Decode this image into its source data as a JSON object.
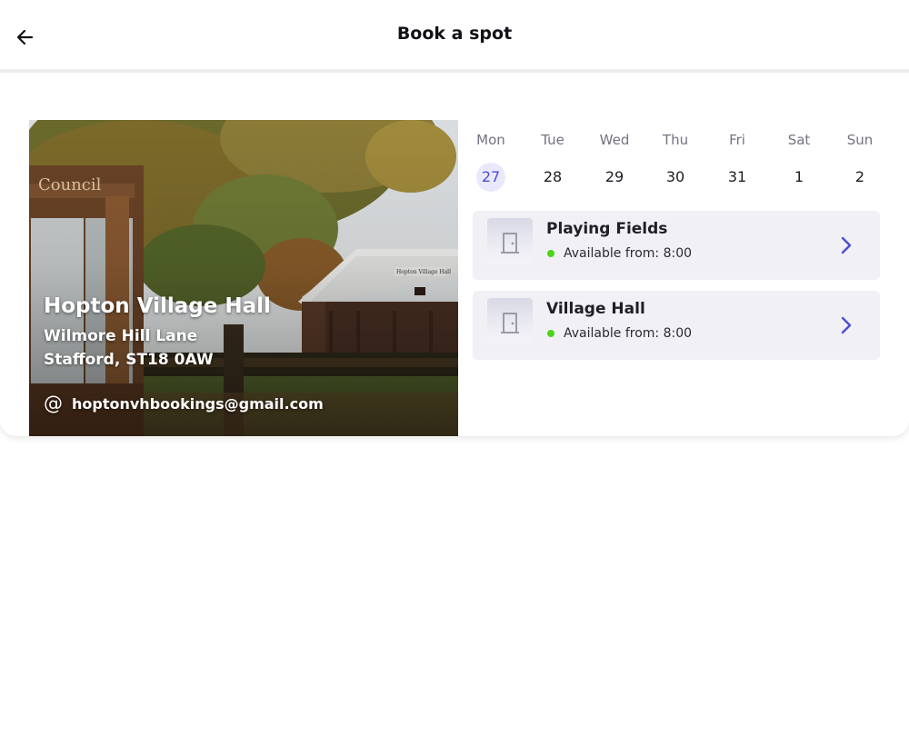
{
  "header": {
    "title": "Book a spot"
  },
  "venue": {
    "name": "Hopton Village Hall",
    "address_line1": "Wilmore Hill Lane",
    "address_line2": "Stafford, ST18 0AW",
    "email": "hoptonvhbookings@gmail.com",
    "photo_sign_text": "Council",
    "photo_hall_sign": "Hopton Village Hall"
  },
  "calendar": {
    "selected_index": 0,
    "days": [
      {
        "name": "Mon",
        "num": "27"
      },
      {
        "name": "Tue",
        "num": "28"
      },
      {
        "name": "Wed",
        "num": "29"
      },
      {
        "name": "Thu",
        "num": "30"
      },
      {
        "name": "Fri",
        "num": "31"
      },
      {
        "name": "Sat",
        "num": "1"
      },
      {
        "name": "Sun",
        "num": "2"
      }
    ]
  },
  "facilities": [
    {
      "name": "Playing Fields",
      "availability": "Available from: 8:00",
      "icon": "door-icon"
    },
    {
      "name": "Village Hall",
      "availability": "Available from: 8:00",
      "icon": "door-icon"
    }
  ],
  "colors": {
    "accent": "#4c4fd6",
    "selected_day_bg": "#e9e9fb",
    "available_dot": "#4cd419",
    "card_bg": "#f0f0f5"
  }
}
